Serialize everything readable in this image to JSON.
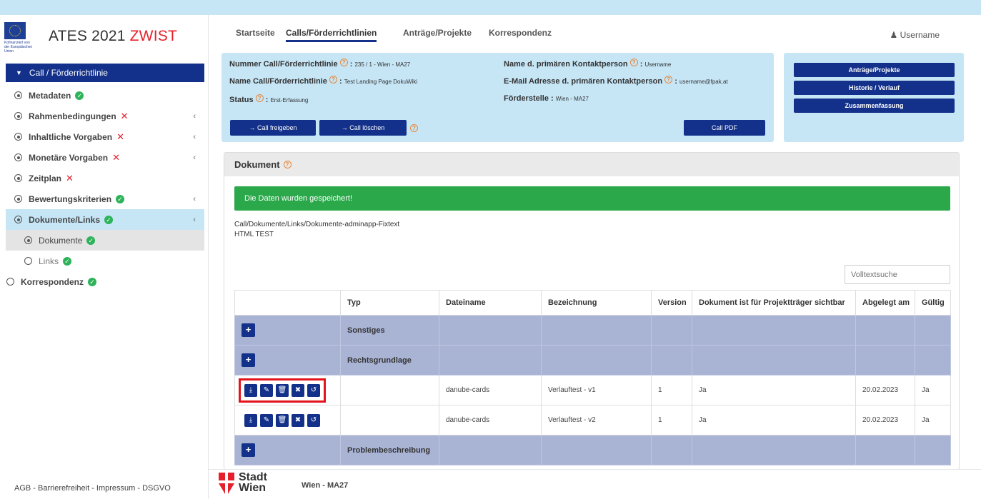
{
  "brand": {
    "eu_caption": "Kofinanziert von der Europäischen Union",
    "title": "ATES 2021",
    "title_accent": "ZWIST"
  },
  "sidebar": {
    "header": "Call / Förderrichtlinie",
    "items": [
      {
        "label": "Metadaten",
        "status": "ok"
      },
      {
        "label": "Rahmenbedingungen",
        "status": "bad"
      },
      {
        "label": "Inhaltliche Vorgaben",
        "status": "bad"
      },
      {
        "label": "Monetäre Vorgaben",
        "status": "bad"
      },
      {
        "label": "Zeitplan",
        "status": "bad"
      },
      {
        "label": "Bewertungskriterien",
        "status": "ok"
      },
      {
        "label": "Dokumente/Links",
        "status": "ok"
      },
      {
        "label": "Dokumente",
        "status": "ok"
      },
      {
        "label": "Links",
        "status": "ok"
      },
      {
        "label": "Korrespondenz",
        "status": "ok"
      }
    ],
    "footer": "AGB - Barrierefreiheit - Impressum - DSGVO"
  },
  "topnav": {
    "tabs": [
      "Startseite",
      "Calls/Förderrichtlinien",
      "Anträge/Projekte",
      "Korrespondenz"
    ],
    "user": "Username"
  },
  "info": {
    "nummer_label": "Nummer Call/Förderrichtlinie",
    "nummer_value": "235 / 1 - Wien - MA27",
    "name_label": "Name Call/Förderrichtlinie",
    "name_value": "Test Landing Page DokuWiki",
    "status_label": "Status",
    "status_value": "Erst-Erfassung",
    "kontakt_label": "Name d. primären Kontaktperson",
    "kontakt_value": "Username",
    "email_label": "E-Mail Adresse d. primären Kontaktperson",
    "email_value": "username@fpak.at",
    "foerder_label": "Förderstelle",
    "foerder_value": "Wien - MA27",
    "btn_freigeben": "→ Call freigeben",
    "btn_loeschen": "→ Call löschen",
    "btn_pdf": "Call PDF"
  },
  "side_buttons": [
    "Anträge/Projekte",
    "Historie / Verlauf",
    "Zusammenfassung"
  ],
  "dokument": {
    "title": "Dokument",
    "alert": "Die Daten wurden gespeichert!",
    "fixtext_path": "Call/Dokumente/Links/Dokumente-adminapp-Fixtext",
    "fixtext_html": "HTML TEST",
    "search_placeholder": "Volltextsuche",
    "columns": [
      "",
      "Typ",
      "Dateiname",
      "Bezeichnung",
      "Version",
      "Dokument ist für Projektträger sichtbar",
      "Abgelegt am",
      "Gültig"
    ],
    "groups": {
      "g1": "Sonstiges",
      "g2": "Rechtsgrundlage",
      "g3": "Problembeschreibung"
    },
    "rows": [
      {
        "dateiname": "danube-cards",
        "bezeichnung": "Verlauftest - v1",
        "version": "1",
        "sichtbar": "Ja",
        "abgelegt": "20.02.2023",
        "gueltig": "Ja"
      },
      {
        "dateiname": "danube-cards",
        "bezeichnung": "Verlauftest - v2",
        "version": "1",
        "sichtbar": "Ja",
        "abgelegt": "20.02.2023",
        "gueltig": "Ja"
      }
    ]
  },
  "footer": {
    "logo_text_1": "Stadt",
    "logo_text_2": "Wien",
    "org": "Wien - MA27"
  },
  "colors": {
    "primary": "#13318a",
    "light_blue": "#c6e6f6",
    "success": "#2aa84a",
    "danger": "#e5202a",
    "group_row": "#a9b3d4"
  }
}
